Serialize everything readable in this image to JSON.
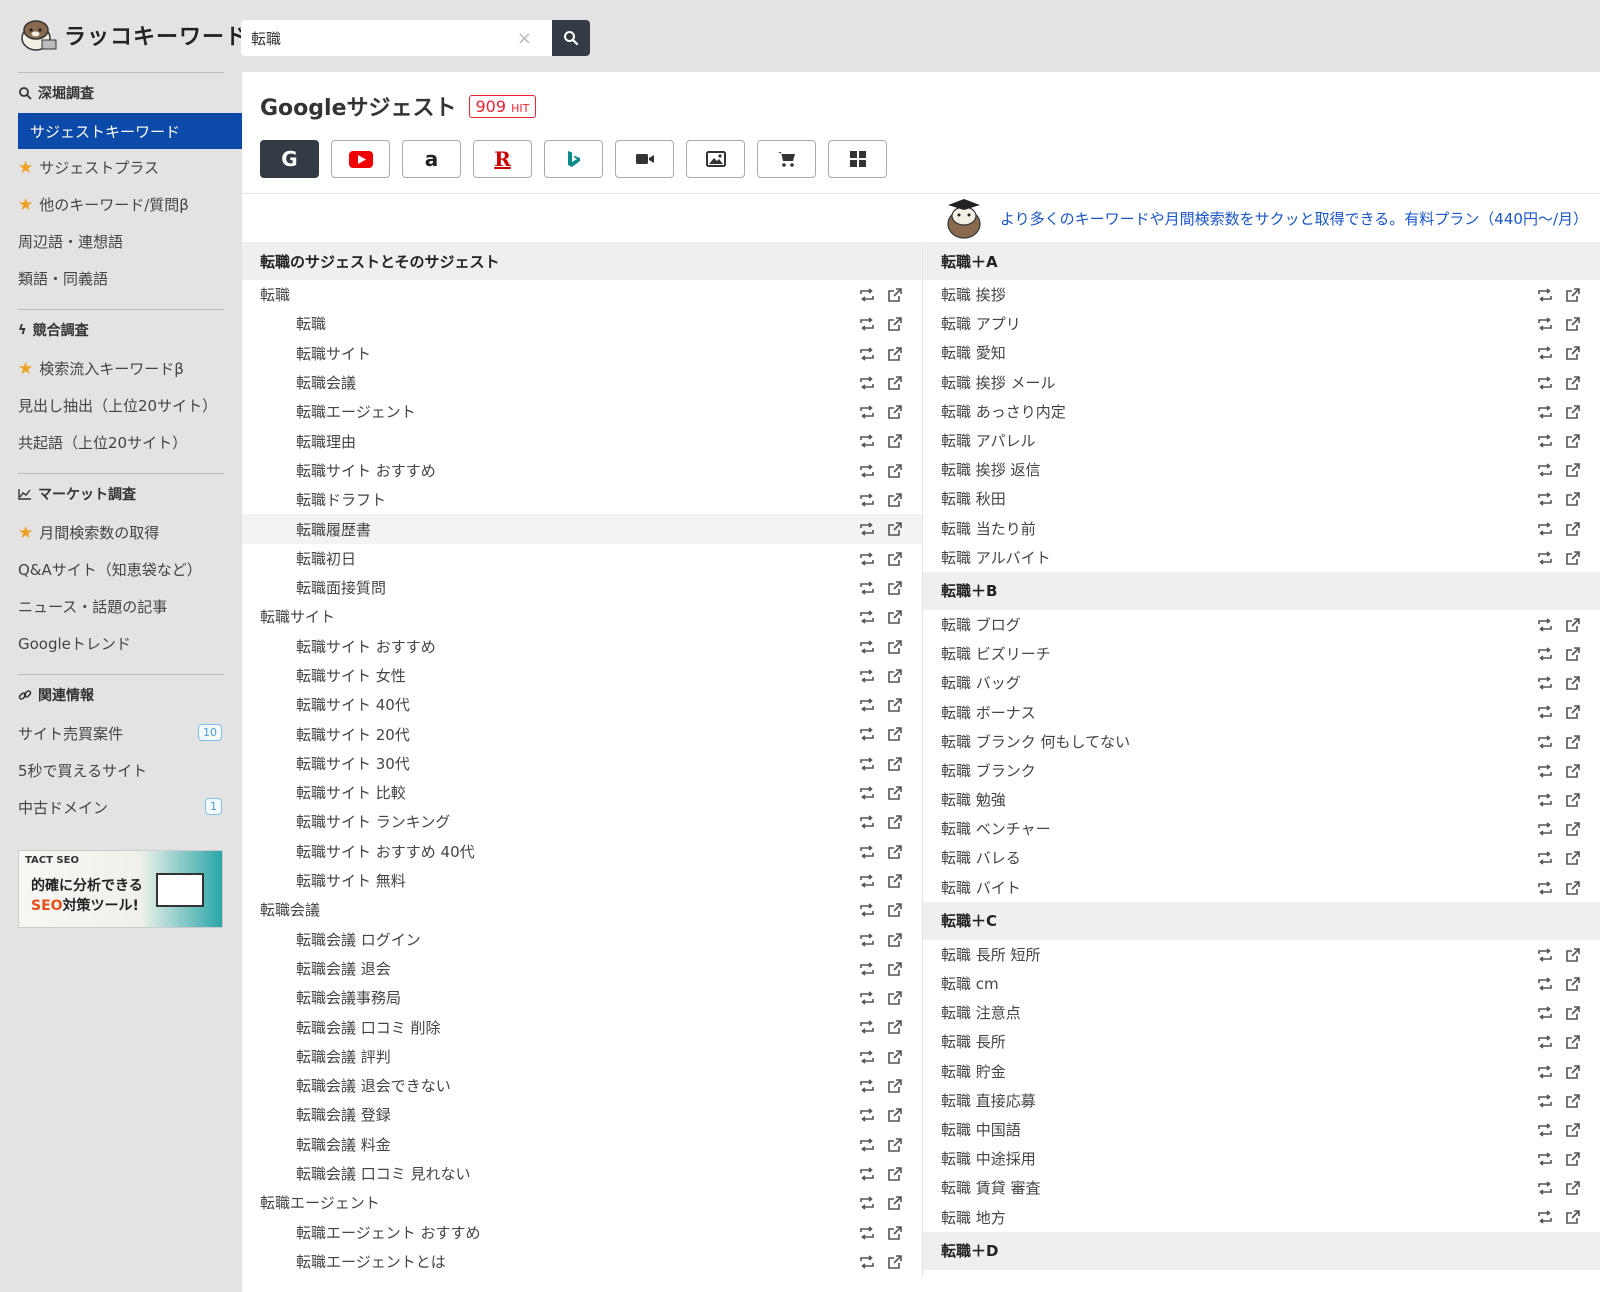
{
  "app": {
    "title": "ラッコキーワード"
  },
  "search": {
    "value": "転職",
    "clear_glyph": "×"
  },
  "sidebar": {
    "sections": [
      {
        "heading": "深堀調査",
        "icon": "search-icon",
        "items": [
          {
            "label": "サジェストキーワード",
            "active": true
          },
          {
            "label": "サジェストプラス",
            "star": true
          },
          {
            "label": "他のキーワード/質問β",
            "star": true
          },
          {
            "label": "周辺語・連想語"
          },
          {
            "label": "類語・同義語"
          }
        ]
      },
      {
        "heading": "競合調査",
        "icon": "bolt-icon",
        "items": [
          {
            "label": "検索流入キーワードβ",
            "star": true
          },
          {
            "label": "見出し抽出（上位20サイト）"
          },
          {
            "label": "共起語（上位20サイト）"
          }
        ]
      },
      {
        "heading": "マーケット調査",
        "icon": "chart-icon",
        "items": [
          {
            "label": "月間検索数の取得",
            "star": true
          },
          {
            "label": "Q&Aサイト（知恵袋など）"
          },
          {
            "label": "ニュース・話題の記事"
          },
          {
            "label": "Googleトレンド"
          }
        ]
      },
      {
        "heading": "関連情報",
        "icon": "link-icon",
        "items": [
          {
            "label": "サイト売買案件",
            "badge": "10"
          },
          {
            "label": "5秒で買えるサイト"
          },
          {
            "label": "中古ドメイン",
            "badge": "1"
          }
        ]
      }
    ],
    "ad": {
      "brand": "TACT SEO",
      "line1": "的確に分析できる",
      "line2_accent": "SEO",
      "line2": "対策ツール!"
    }
  },
  "main": {
    "title": "Googleサジェスト",
    "hit_count": "909",
    "hit_unit": "HIT",
    "engines": [
      "google",
      "youtube",
      "amazon",
      "rakuten",
      "bing",
      "video",
      "image",
      "shopping",
      "apps"
    ],
    "promo": "より多くのキーワードや月間検索数をサクッと取得できる。有料プラン（440円〜/月）"
  },
  "left_column": {
    "heading": "転職のサジェストとそのサジェスト",
    "rows": [
      {
        "text": "転職",
        "level": 0
      },
      {
        "text": "転職",
        "level": 1
      },
      {
        "text": "転職サイト",
        "level": 1
      },
      {
        "text": "転職会議",
        "level": 1
      },
      {
        "text": "転職エージェント",
        "level": 1
      },
      {
        "text": "転職理由",
        "level": 1
      },
      {
        "text": "転職サイト おすすめ",
        "level": 1
      },
      {
        "text": "転職ドラフト",
        "level": 1
      },
      {
        "text": "転職履歴書",
        "level": 1,
        "highlight": true
      },
      {
        "text": "転職初日",
        "level": 1
      },
      {
        "text": "転職面接質問",
        "level": 1
      },
      {
        "text": "転職サイト",
        "level": 0
      },
      {
        "text": "転職サイト おすすめ",
        "level": 1
      },
      {
        "text": "転職サイト 女性",
        "level": 1
      },
      {
        "text": "転職サイト 40代",
        "level": 1
      },
      {
        "text": "転職サイト 20代",
        "level": 1
      },
      {
        "text": "転職サイト 30代",
        "level": 1
      },
      {
        "text": "転職サイト 比較",
        "level": 1
      },
      {
        "text": "転職サイト ランキング",
        "level": 1
      },
      {
        "text": "転職サイト おすすめ 40代",
        "level": 1
      },
      {
        "text": "転職サイト 無料",
        "level": 1
      },
      {
        "text": "転職会議",
        "level": 0
      },
      {
        "text": "転職会議 ログイン",
        "level": 1
      },
      {
        "text": "転職会議 退会",
        "level": 1
      },
      {
        "text": "転職会議事務局",
        "level": 1
      },
      {
        "text": "転職会議 口コミ 削除",
        "level": 1
      },
      {
        "text": "転職会議 評判",
        "level": 1
      },
      {
        "text": "転職会議 退会できない",
        "level": 1
      },
      {
        "text": "転職会議 登録",
        "level": 1
      },
      {
        "text": "転職会議 料金",
        "level": 1
      },
      {
        "text": "転職会議 口コミ 見れない",
        "level": 1
      },
      {
        "text": "転職エージェント",
        "level": 0
      },
      {
        "text": "転職エージェント おすすめ",
        "level": 1
      },
      {
        "text": "転職エージェントとは",
        "level": 1
      }
    ]
  },
  "right_column": {
    "groups": [
      {
        "heading": "転職＋A",
        "rows": [
          "転職 挨拶",
          "転職 アプリ",
          "転職 愛知",
          "転職 挨拶 メール",
          "転職 あっさり内定",
          "転職 アパレル",
          "転職 挨拶 返信",
          "転職 秋田",
          "転職 当たり前",
          "転職 アルバイト"
        ]
      },
      {
        "heading": "転職＋B",
        "rows": [
          "転職 ブログ",
          "転職 ビズリーチ",
          "転職 バッグ",
          "転職 ボーナス",
          "転職 ブランク 何もしてない",
          "転職 ブランク",
          "転職 勉強",
          "転職 ベンチャー",
          "転職 バレる",
          "転職 バイト"
        ]
      },
      {
        "heading": "転職＋C",
        "rows": [
          "転職 長所 短所",
          "転職 cm",
          "転職 注意点",
          "転職 長所",
          "転職 貯金",
          "転職 直接応募",
          "転職 中国語",
          "転職 中途採用",
          "転職 賃貸 審査",
          "転職 地方"
        ]
      },
      {
        "heading": "転職＋D",
        "rows": []
      }
    ]
  },
  "colors": {
    "accent": "#0b4aa8",
    "hit_red": "#e22233",
    "link_blue": "#1a56c8",
    "dark_btn": "#333b44",
    "star": "#f0a020"
  }
}
